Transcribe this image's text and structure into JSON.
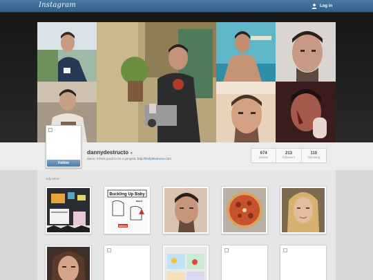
{
  "header": {
    "brand": "Instagram",
    "login_label": "Log in"
  },
  "profile": {
    "username": "dannydestructo",
    "username_caret": "▾",
    "bio_text": "damn, it feels good to be a gangsta.",
    "bio_link": "http://findydestructo.com",
    "follow_label": "Follow"
  },
  "stats": [
    {
      "count": "674",
      "label": "photos"
    },
    {
      "count": "213",
      "label": "followers"
    },
    {
      "count": "110",
      "label": "following"
    }
  ],
  "feed": {
    "month_label": "July 2015",
    "photos": [
      {
        "name": "nursery-photo"
      },
      {
        "name": "bucklin-up-baby-photo",
        "sign_title": "Buckling Up Baby",
        "sign_right": "RIGHT",
        "sign_wrong": "WRONG"
      },
      {
        "name": "man-portrait-photo"
      },
      {
        "name": "pizza-photo"
      },
      {
        "name": "blonde-woman-photo"
      },
      {
        "name": "brunette-woman-photo"
      },
      {
        "name": "broken-image-photo"
      },
      {
        "name": "toy-bins-photo"
      },
      {
        "name": "broken-image-photo-2"
      },
      {
        "name": "broken-image-photo-3"
      }
    ]
  },
  "colors": {
    "topbar": "#3b6a96",
    "follow_button": "#5b88b1",
    "link": "#3d6e99"
  }
}
